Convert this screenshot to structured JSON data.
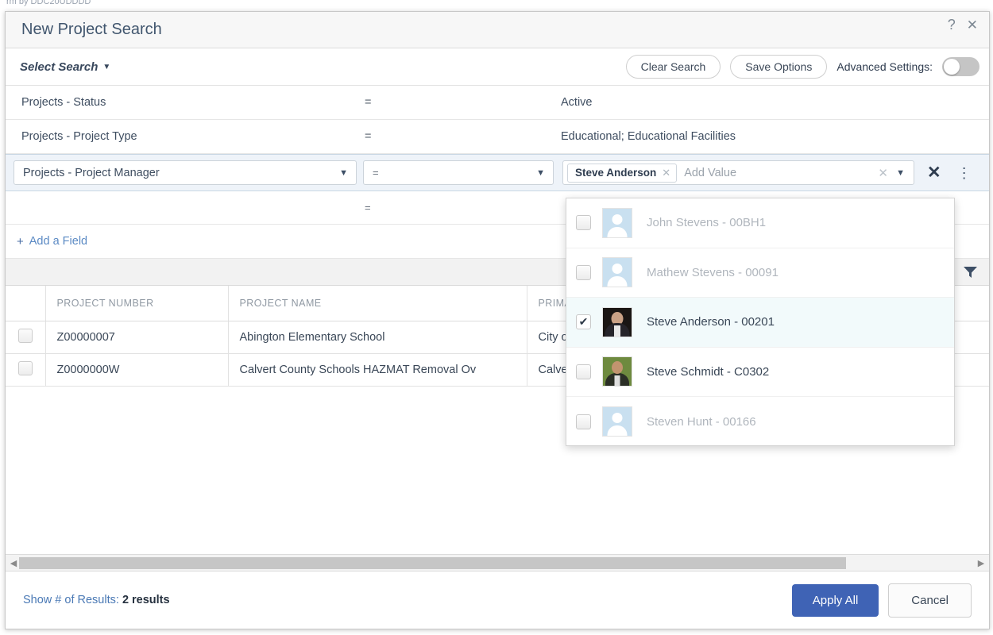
{
  "background": {
    "ghost_text": "rm by DDC20UDDDD"
  },
  "dialog": {
    "title": "New Project Search",
    "help_icon": "?",
    "close_icon": "✕"
  },
  "toolbar": {
    "select_search_label": "Select Search",
    "select_search_caret": "▼",
    "clear_search_label": "Clear Search",
    "save_options_label": "Save Options",
    "advanced_settings_label": "Advanced Settings:",
    "advanced_settings_on": false
  },
  "criteria": {
    "rows": [
      {
        "field": "Projects - Status",
        "operator": "=",
        "value": "Active"
      },
      {
        "field": "Projects - Project Type",
        "operator": "=",
        "value": "Educational; Educational Facilities"
      }
    ],
    "active_row": {
      "field": "Projects - Project Manager",
      "field_caret": "▼",
      "operator": "=",
      "operator_caret": "▼",
      "token": "Steve Anderson",
      "token_remove": "✕",
      "value_placeholder": "Add Value",
      "clear_icon": "✕",
      "caret_icon": "▼",
      "remove_row_icon": "✕",
      "row_menu_icon": "⋮"
    },
    "empty_row": {
      "operator": "="
    },
    "add_field_label": "Add a Field",
    "add_field_plus": "+"
  },
  "project_manager_dropdown": {
    "options": [
      {
        "label": "John Stevens - 00BH1",
        "checked": false,
        "avatar": "generic",
        "muted": true
      },
      {
        "label": "Mathew Stevens - 00091",
        "checked": false,
        "avatar": "generic",
        "muted": true
      },
      {
        "label": "Steve Anderson - 00201",
        "checked": true,
        "avatar": "photo1",
        "muted": false
      },
      {
        "label": "Steve Schmidt - C0302",
        "checked": false,
        "avatar": "photo2",
        "muted": false
      },
      {
        "label": "Steven Hunt - 00166",
        "checked": false,
        "avatar": "generic",
        "muted": true
      }
    ],
    "check_glyph": "✔"
  },
  "grid_toolbar": {
    "export_icon": "export-icon",
    "filter_icon": "filter-icon"
  },
  "results_table": {
    "columns": [
      "",
      "PROJECT NUMBER",
      "PROJECT NAME",
      "PRIMARY"
    ],
    "rows": [
      {
        "number": "Z00000007",
        "name": "Abington Elementary School",
        "primary": "City of Boston A"
      },
      {
        "number": "Z0000000W",
        "name": "Calvert County Schools HAZMAT Removal Ov",
        "primary": "Calvert San Fran"
      }
    ]
  },
  "footer": {
    "results_label": "Show # of Results:",
    "results_count": "2 results",
    "apply_all_label": "Apply All",
    "cancel_label": "Cancel"
  },
  "colors": {
    "accent_blue": "#3f63b5",
    "title_text": "#41566e",
    "link_blue": "#5b8ac4",
    "active_row_bg": "#eef3f9",
    "selected_option_bg": "#f2fafb"
  }
}
